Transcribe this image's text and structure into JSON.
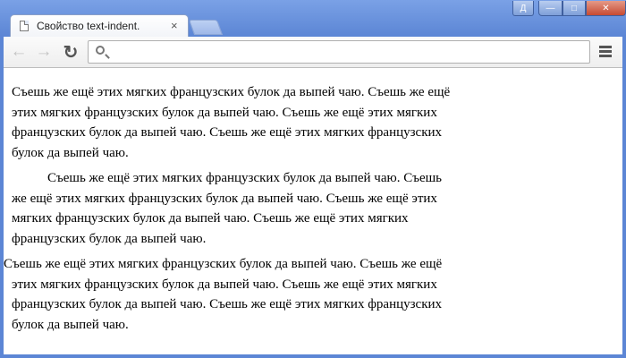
{
  "window": {
    "controls": {
      "lang": "Д",
      "minimize": "—",
      "maximize": "□",
      "close": "✕"
    }
  },
  "tab": {
    "title": "Свойство text-indent.",
    "close": "×"
  },
  "toolbar": {
    "back": "←",
    "forward": "→",
    "reload": "↻",
    "omnibox": {
      "value": ""
    }
  },
  "content": {
    "paragraphs": [
      "Съешь же ещё этих мягких французских булок да выпей чаю. Съешь же ещё этих мягких французских булок да выпей чаю. Съешь же ещё этих мягких французских булок да выпей чаю. Съешь же ещё этих мягких французских булок да выпей чаю.",
      "Съешь же ещё этих мягких французских булок да выпей чаю. Съешь же ещё этих мягких французских булок да выпей чаю. Съешь же ещё этих мягких французских булок да выпей чаю. Съешь же ещё этих мягких французских булок да выпей чаю.",
      "Съешь же ещё этих мягких французских булок да выпей чаю. Съешь же ещё этих мягких французских булок да выпей чаю. Съешь же ещё этих мягких французских булок да выпей чаю. Съешь же ещё этих мягких французских булок да выпей чаю."
    ]
  }
}
